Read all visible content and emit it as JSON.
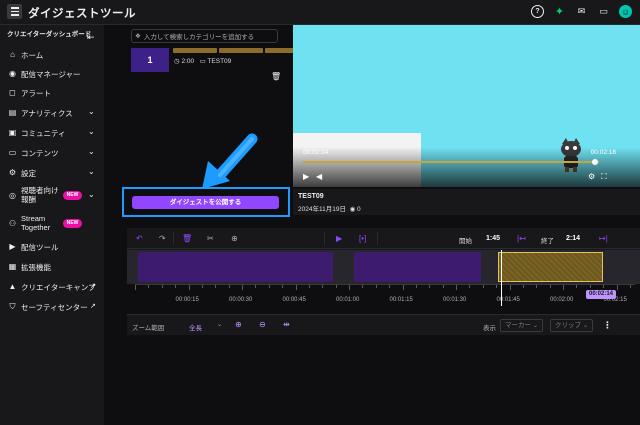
{
  "app": {
    "title": "ダイジェストツール"
  },
  "topbar": {
    "icons": [
      "help-icon",
      "sparkle-icon",
      "inbox-icon",
      "chat-icon",
      "avatar"
    ]
  },
  "sidebar": {
    "header": "クリエイターダッシュボード",
    "items": [
      {
        "label": "ホーム",
        "icon": "home-icon"
      },
      {
        "label": "配信マネージャー",
        "icon": "broadcast-icon"
      },
      {
        "label": "アラート",
        "icon": "alert-icon"
      },
      {
        "label": "アナリティクス",
        "icon": "analytics-icon"
      },
      {
        "label": "コミュニティ",
        "icon": "community-icon"
      },
      {
        "label": "コンテンツ",
        "icon": "content-icon"
      },
      {
        "label": "設定",
        "icon": "settings-icon"
      },
      {
        "label": "視聴者向け報酬",
        "icon": "rewards-icon",
        "badge": "NEW"
      },
      {
        "label": "Stream Together",
        "icon": "stream-together-icon",
        "badge": "NEW"
      },
      {
        "label": "配信ツール",
        "icon": "stream-tools-icon"
      },
      {
        "label": "拡張機能",
        "icon": "extensions-icon"
      },
      {
        "label": "クリエイターキャンプ",
        "icon": "camp-icon"
      },
      {
        "label": "セーフティセンター",
        "icon": "safety-icon"
      }
    ]
  },
  "editor": {
    "category_placeholder": "入力して検索しカテゴリーを追加する",
    "clip": {
      "number": "1",
      "duration": "2:00",
      "title": "TEST09"
    }
  },
  "player": {
    "time_current": "00:02:14",
    "time_total": "00:02:18",
    "progress": 0.97
  },
  "video": {
    "title": "TEST09",
    "date": "2024年11月19日",
    "views": "0"
  },
  "publish": {
    "label": "ダイジェストを公開する"
  },
  "timeline": {
    "start_label": "開始",
    "start_value": "1:45",
    "end_label": "終了",
    "end_value": "2:14",
    "ticks": [
      "00:00:15",
      "00:00:30",
      "00:00:45",
      "00:01:00",
      "00:01:15",
      "00:01:30",
      "00:01:45",
      "00:02:00",
      "00:02:15"
    ],
    "playhead": "00:02:14",
    "zoom_label": "ズーム範囲",
    "zoom_value": "全長",
    "display_label": "表示",
    "marker_dropdown": "マーカー",
    "clip_dropdown": "クリップ"
  },
  "colors": {
    "accent": "#9147ff",
    "highlight": "#1e9bff",
    "selection": "#e6c15a"
  }
}
